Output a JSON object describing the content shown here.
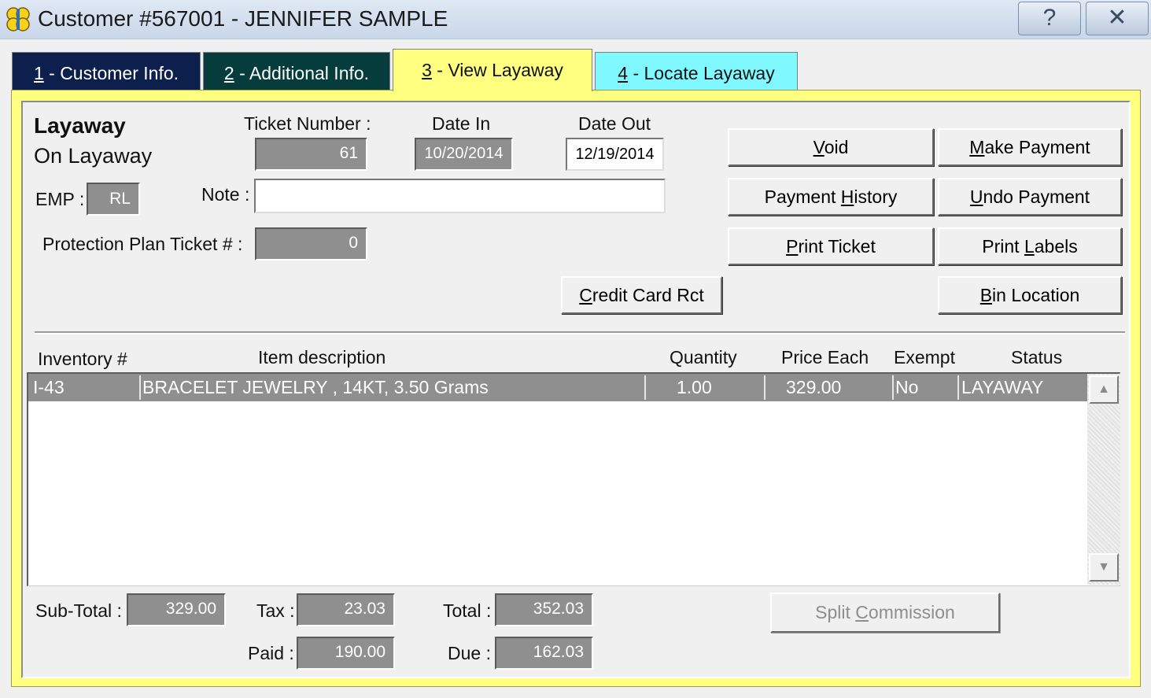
{
  "window": {
    "title": "Customer #567001 - JENNIFER SAMPLE",
    "help_label": "?",
    "close_label": "✕"
  },
  "tabs": [
    {
      "key": "1",
      "label": " - Customer Info."
    },
    {
      "key": "2",
      "label": " - Additional Info."
    },
    {
      "key": "3",
      "label": " - View Layaway"
    },
    {
      "key": "4",
      "label": " - Locate Layaway"
    }
  ],
  "colors": {
    "tab1": "#0c1f4d",
    "tab2": "#063d3c",
    "tab3": "#ffff80",
    "tab4": "#7ff9ff",
    "panel": "#ffff80"
  },
  "layaway": {
    "heading": "Layaway",
    "status": "On Layaway",
    "emp_label": "EMP :",
    "emp_value": "RL",
    "ticket_label": "Ticket Number :",
    "ticket_value": "61",
    "date_in_label": "Date In",
    "date_in_value": "10/20/2014",
    "date_out_label": "Date Out",
    "date_out_value": "12/19/2014",
    "note_label": "Note :",
    "note_value": "",
    "protection_label": "Protection Plan Ticket # :",
    "protection_value": "0"
  },
  "buttons": {
    "void": {
      "mn": "V",
      "rest": "oid"
    },
    "make_payment": {
      "mn": "M",
      "rest": "ake Payment"
    },
    "payment_history": {
      "pre": "Payment ",
      "mn": "H",
      "rest": "istory"
    },
    "undo_payment": {
      "mn": "U",
      "rest": "ndo Payment"
    },
    "print_ticket": {
      "mn": "P",
      "rest": "rint Ticket"
    },
    "print_labels": {
      "pre": "Print ",
      "mn": "L",
      "rest": "abels"
    },
    "credit_card": {
      "mn": "C",
      "rest": "redit Card Rct"
    },
    "bin_location": {
      "mn": "B",
      "rest": "in Location"
    },
    "split_commission": {
      "pre": "Split ",
      "mn": "C",
      "rest": "ommission"
    }
  },
  "items_table": {
    "headers": [
      "Inventory #",
      "Item description",
      "Quantity",
      "Price Each",
      "Exempt",
      "Status"
    ],
    "rows": [
      [
        "I-43",
        "BRACELET JEWELRY , 14KT, 3.50 Grams",
        "1.00",
        "329.00",
        "No",
        "LAYAWAY"
      ]
    ]
  },
  "totals": {
    "subtotal_label": "Sub-Total :",
    "subtotal": "329.00",
    "tax_label": "Tax :",
    "tax": "23.03",
    "total_label": "Total :",
    "total": "352.03",
    "paid_label": "Paid :",
    "paid": "190.00",
    "due_label": "Due :",
    "due": "162.03"
  }
}
